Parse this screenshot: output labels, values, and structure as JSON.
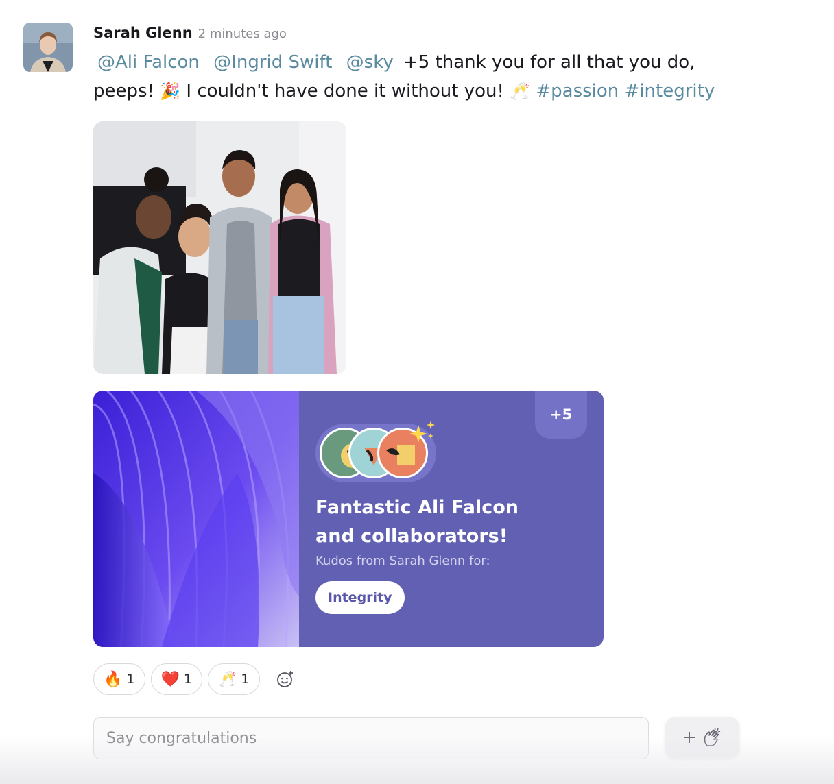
{
  "post": {
    "author": "Sarah Glenn",
    "timestamp": "2 minutes ago",
    "mentions": [
      "@Ali Falcon",
      "@Ingrid Swift",
      "@sky"
    ],
    "text_part1": "+5 thank you for all that you do, peeps!",
    "emoji_party": "🎉",
    "text_part2": "I couldn't have done it without you!",
    "emoji_cheers": "🥂",
    "hashtags": [
      "#passion",
      "#integrity"
    ]
  },
  "card": {
    "points": "+5",
    "title": "Fantastic Ali Falcon and collaborators!",
    "subtitle": "Kudos from Sarah Glenn for:",
    "value": "Integrity"
  },
  "reactions": [
    {
      "emoji": "🔥",
      "count": "1"
    },
    {
      "emoji": "❤️",
      "count": "1"
    },
    {
      "emoji": "🥂",
      "count": "1"
    }
  ],
  "comment": {
    "placeholder": "Say congratulations"
  },
  "icons": {
    "add_reaction": "smiley-plus-icon",
    "kudos": "clapping-hands-icon"
  },
  "colors": {
    "mention": "#5a8aa0",
    "card_background": "#6260b2",
    "value_text": "#5a58a8"
  }
}
